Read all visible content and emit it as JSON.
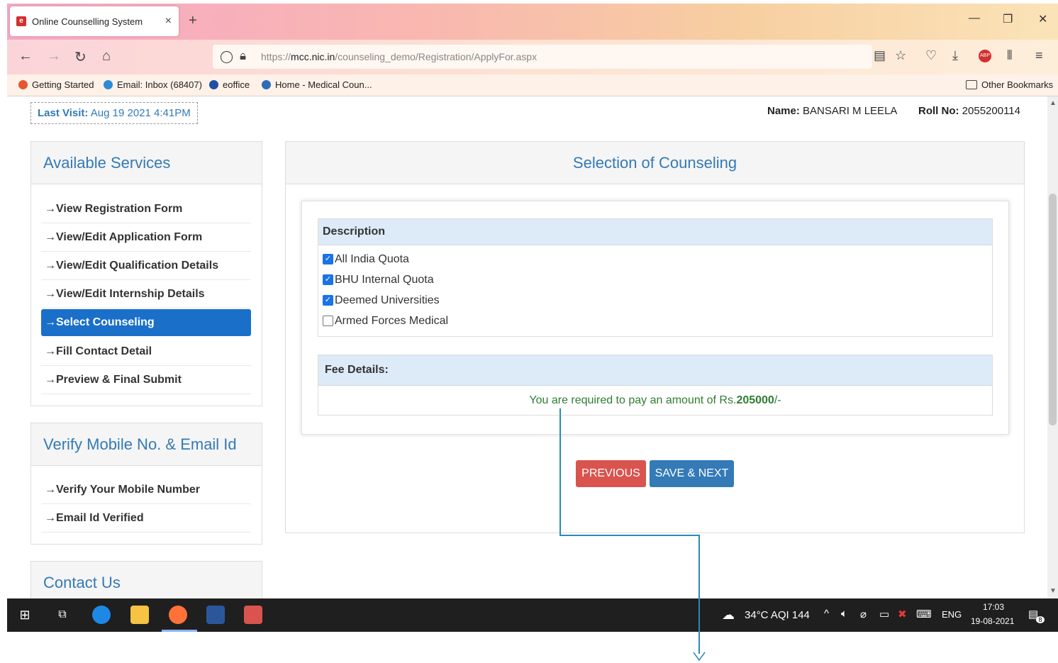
{
  "browser": {
    "tab_title": "Online Counselling System",
    "tab_close": "×",
    "new_tab": "+",
    "url_prefix": "https://",
    "url_domain": "mcc.nic.in",
    "url_path": "/counseling_demo/Registration/ApplyFor.aspx",
    "bookmarks": [
      {
        "label": "Getting Started",
        "color": "#e8552f"
      },
      {
        "label": "Email: Inbox (68407)",
        "color": "#2d8cd8"
      },
      {
        "label": "eoffice",
        "color": "#1e4fa3"
      },
      {
        "label": "Home - Medical Coun...",
        "color": "#2e6cb5"
      }
    ],
    "other_bookmarks": "Other Bookmarks"
  },
  "header": {
    "last_visit_label": "Last Visit:",
    "last_visit_value": "Aug 19 2021 4:41PM",
    "name_label": "Name:",
    "name_value": "BANSARI M LEELA",
    "roll_label": "Roll No:",
    "roll_value": "2055200114"
  },
  "sidebar": {
    "services_title": "Available Services",
    "services": [
      {
        "label": "View Registration Form",
        "active": false
      },
      {
        "label": "View/Edit Application Form",
        "active": false
      },
      {
        "label": "View/Edit Qualification Details",
        "active": false
      },
      {
        "label": "View/Edit Internship Details",
        "active": false
      },
      {
        "label": "Select Counseling",
        "active": true
      },
      {
        "label": "Fill Contact Detail",
        "active": false
      },
      {
        "label": "Preview & Final Submit",
        "active": false
      }
    ],
    "verify_title": "Verify Mobile No. & Email Id",
    "verify_items": [
      {
        "label": "Verify Your Mobile Number"
      },
      {
        "label": "Email Id Verified"
      }
    ],
    "contact_title": "Contact Us"
  },
  "main": {
    "title": "Selection of Counseling",
    "description_header": "Description",
    "quotas": [
      {
        "label": "All India Quota",
        "checked": true
      },
      {
        "label": "BHU Internal Quota",
        "checked": true
      },
      {
        "label": "Deemed Universities",
        "checked": true
      },
      {
        "label": "Armed Forces Medical",
        "checked": false
      }
    ],
    "fee_header": "Fee Details:",
    "fee_text_prefix": "You are required to pay an amount of Rs.",
    "fee_amount": "205000",
    "fee_text_suffix": "/-",
    "previous_label": "PREVIOUS",
    "save_next_label": "SAVE & NEXT"
  },
  "taskbar": {
    "weather": "34°C  AQI 144",
    "language": "ENG",
    "time": "17:03",
    "date": "19-08-2021",
    "notification_count": "8"
  },
  "colors": {
    "accent": "#337ab7",
    "active_menu": "#1a6fc9",
    "previous_button": "#d9534f",
    "save_button": "#337ab7",
    "fee_text": "#2e7d32"
  }
}
